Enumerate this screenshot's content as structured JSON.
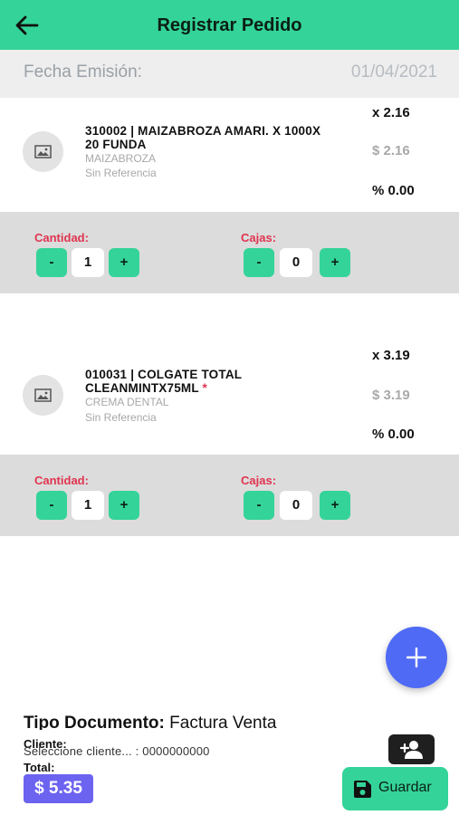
{
  "header": {
    "title": "Registrar Pedido",
    "back_icon": "arrow-left-icon"
  },
  "issue_date": {
    "label": "Fecha Emisión:",
    "value": "01/04/2021"
  },
  "products": [
    {
      "name": "310002 | MAIZABROZA AMARI. X 1000X 20 FUNDA",
      "required_mark": "",
      "brand": "MAIZABROZA",
      "reference": "Sin Referencia",
      "qty_text": "x 2.16",
      "price": "$ 2.16",
      "discount": "% 0.00",
      "quantity_label": "Cantidad:",
      "quantity": "1",
      "boxes_label": "Cajas:",
      "boxes": "0",
      "minus": "-",
      "plus": "+"
    },
    {
      "name": "010031 | COLGATE TOTAL CLEANMINTX75ML",
      "required_mark": "*",
      "brand": "CREMA DENTAL",
      "reference": "Sin Referencia",
      "qty_text": "x 3.19",
      "price": "$ 3.19",
      "discount": "% 0.00",
      "quantity_label": "Cantidad:",
      "quantity": "1",
      "boxes_label": "Cajas:",
      "boxes": "0",
      "minus": "-",
      "plus": "+"
    }
  ],
  "document": {
    "label": "Tipo Documento:",
    "value": "Factura Venta"
  },
  "client": {
    "label": "Cliente:",
    "value": "Seleccione cliente... : 0000000000"
  },
  "total": {
    "label": "Total:",
    "value": "$ 5.35"
  },
  "save_button": {
    "label": "Guardar"
  },
  "colors": {
    "accent": "#34d399",
    "fab": "#4f6af5",
    "total_badge": "#6c63f0",
    "required": "#e0344f"
  }
}
